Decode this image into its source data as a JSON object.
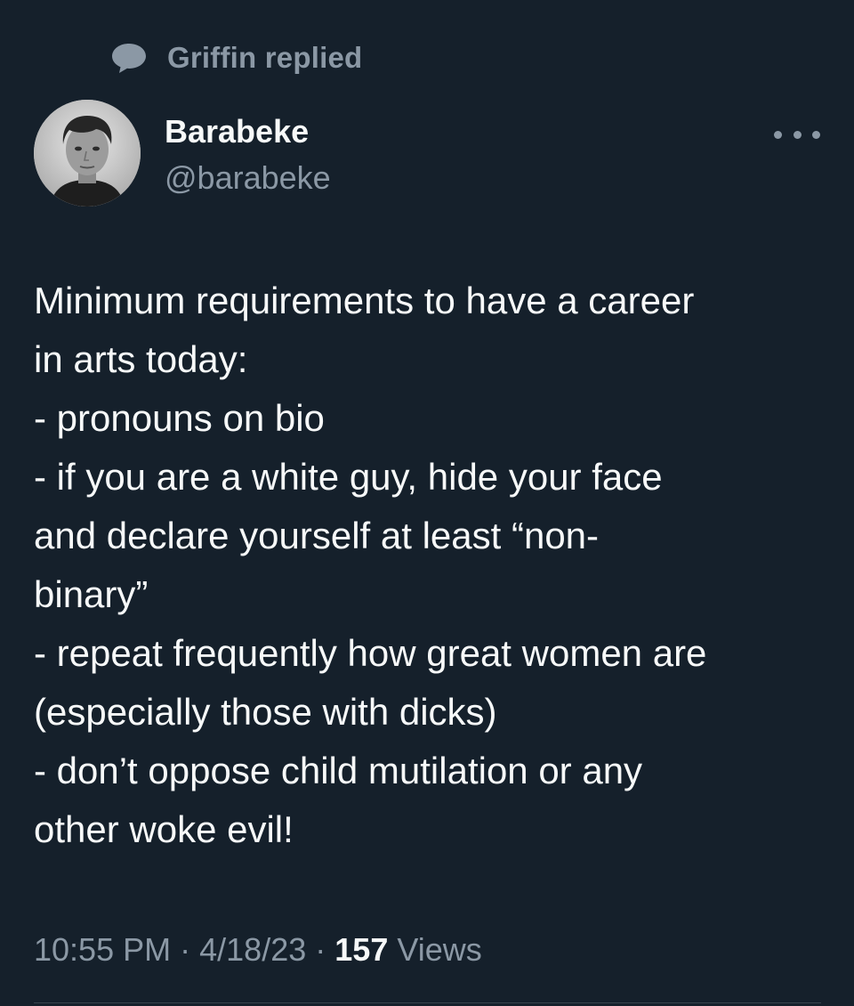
{
  "context": {
    "icon": "speech-bubble-icon",
    "label": "Griffin replied"
  },
  "author": {
    "display_name": "Barabeke",
    "handle": "@barabeke",
    "avatar": "avatar-photo"
  },
  "more_icon": "more-dots-icon",
  "tweet": {
    "lines": [
      "Minimum requirements to have a career",
      "in arts today:",
      "- pronouns on bio",
      "- if you are a white guy, hide your face",
      "and declare yourself at least “non-",
      "binary”",
      "- repeat frequently how great women are",
      "(especially those with dicks)",
      "- don’t oppose child mutilation or any",
      "other woke evil!"
    ]
  },
  "meta": {
    "time": "10:55 PM",
    "separator": "·",
    "date": "4/18/23",
    "views_count": "157",
    "views_label": "Views"
  },
  "colors": {
    "background": "#15202b",
    "primary_text": "#f7f9f9",
    "secondary_text": "#8b98a5",
    "divider": "#38444d"
  }
}
